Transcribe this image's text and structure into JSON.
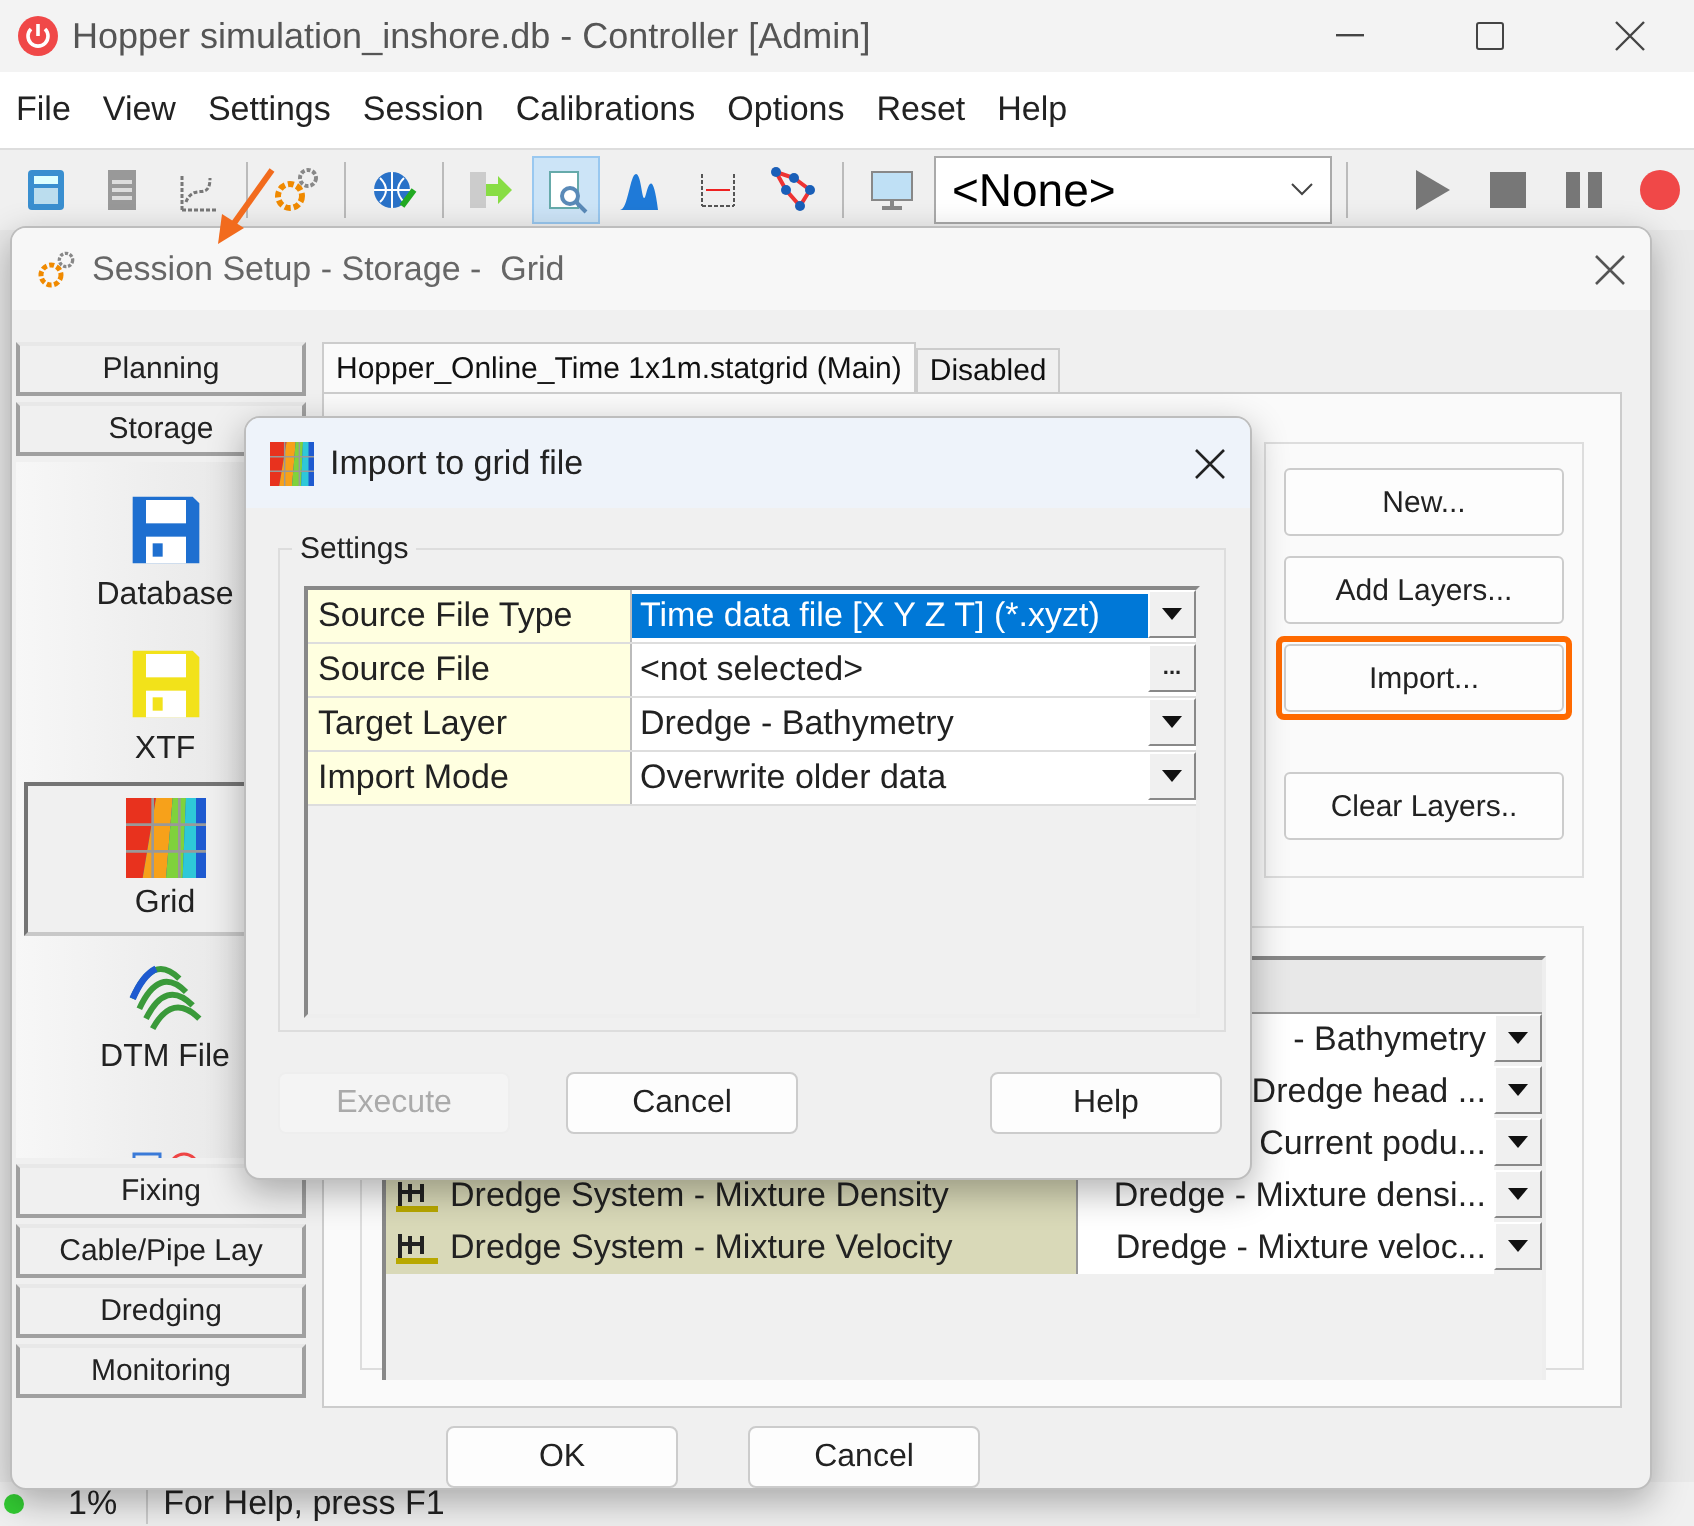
{
  "window": {
    "title": "Hopper simulation_inshore.db - Controller [Admin]"
  },
  "menu": [
    "File",
    "View",
    "Settings",
    "Session",
    "Calibrations",
    "Options",
    "Reset",
    "Help"
  ],
  "toolbar": {
    "buttons": [
      {
        "kind": "calculator",
        "selected": false
      },
      {
        "kind": "document",
        "selected": false
      },
      {
        "kind": "curve",
        "selected": false
      },
      {
        "kind": "gears",
        "selected": false
      },
      {
        "kind": "globe",
        "selected": false
      },
      {
        "kind": "export",
        "selected": false
      },
      {
        "kind": "inspect",
        "selected": true
      },
      {
        "kind": "peaks",
        "selected": false
      },
      {
        "kind": "ruler",
        "selected": false
      },
      {
        "kind": "network",
        "selected": false
      },
      {
        "kind": "monitor",
        "selected": false
      }
    ],
    "combo": "<None>",
    "transport": [
      {
        "kind": "play"
      },
      {
        "kind": "stop"
      },
      {
        "kind": "pause"
      },
      {
        "kind": "record"
      }
    ]
  },
  "session_dialog": {
    "title": "Session Setup - Storage -  Grid",
    "sections_top": [
      "Planning",
      "Storage"
    ],
    "items": [
      {
        "kind": "database",
        "label": "Database",
        "selected": false
      },
      {
        "kind": "xtf",
        "label": "XTF",
        "selected": false
      },
      {
        "kind": "grid",
        "label": "Grid",
        "selected": true
      },
      {
        "kind": "dtm",
        "label": "DTM File",
        "selected": false
      },
      {
        "kind": "shapes",
        "selected": false
      }
    ],
    "sections_bottom": [
      "Fixing",
      "Cable/Pipe Lay",
      "Dredging",
      "Monitoring"
    ],
    "tabs": [
      {
        "label": "Hopper_Online_Time 1x1m.statgrid (Main)",
        "selected": true
      },
      {
        "label": "Disabled",
        "selected": false
      }
    ],
    "actions": [
      {
        "label": "New...",
        "highlighted": false
      },
      {
        "label": "Add Layers...",
        "highlighted": false
      },
      {
        "label": "Import...",
        "highlighted": true
      },
      {
        "label": "Clear Layers..",
        "highlighted": false
      }
    ],
    "layers": [
      {
        "layer": "- Bathymetry"
      },
      {
        "layer": "Dredge head ..."
      },
      {
        "layer": "Current podu..."
      },
      {
        "name": "Dredge System - Mixture Density",
        "layer": "Dredge - Mixture densi..."
      },
      {
        "name": "Dredge System - Mixture Velocity",
        "layer": "Dredge - Mixture veloc..."
      }
    ],
    "footer": [
      "OK",
      "Cancel"
    ]
  },
  "import_dialog": {
    "title": "Import to grid file",
    "group": "Settings",
    "properties": [
      {
        "label": "Source File Type",
        "value": "Time data file [X Y Z T] (*.xyzt)",
        "selected": true,
        "kind": "dropdown"
      },
      {
        "label": "Source File",
        "value": "<not selected>",
        "selected": false,
        "kind": "browse",
        "button": "..."
      },
      {
        "label": "Target Layer",
        "value": "Dredge - Bathymetry",
        "selected": false,
        "kind": "dropdown"
      },
      {
        "label": "Import Mode",
        "value": "Overwrite older data",
        "selected": false,
        "kind": "dropdown"
      }
    ],
    "buttons": [
      {
        "label": "Execute",
        "disabled": true
      },
      {
        "label": "Cancel",
        "disabled": false
      },
      {
        "label": "Help",
        "disabled": false
      }
    ]
  },
  "status_bar": {
    "progress": "1%",
    "message": "For Help, press F1"
  }
}
